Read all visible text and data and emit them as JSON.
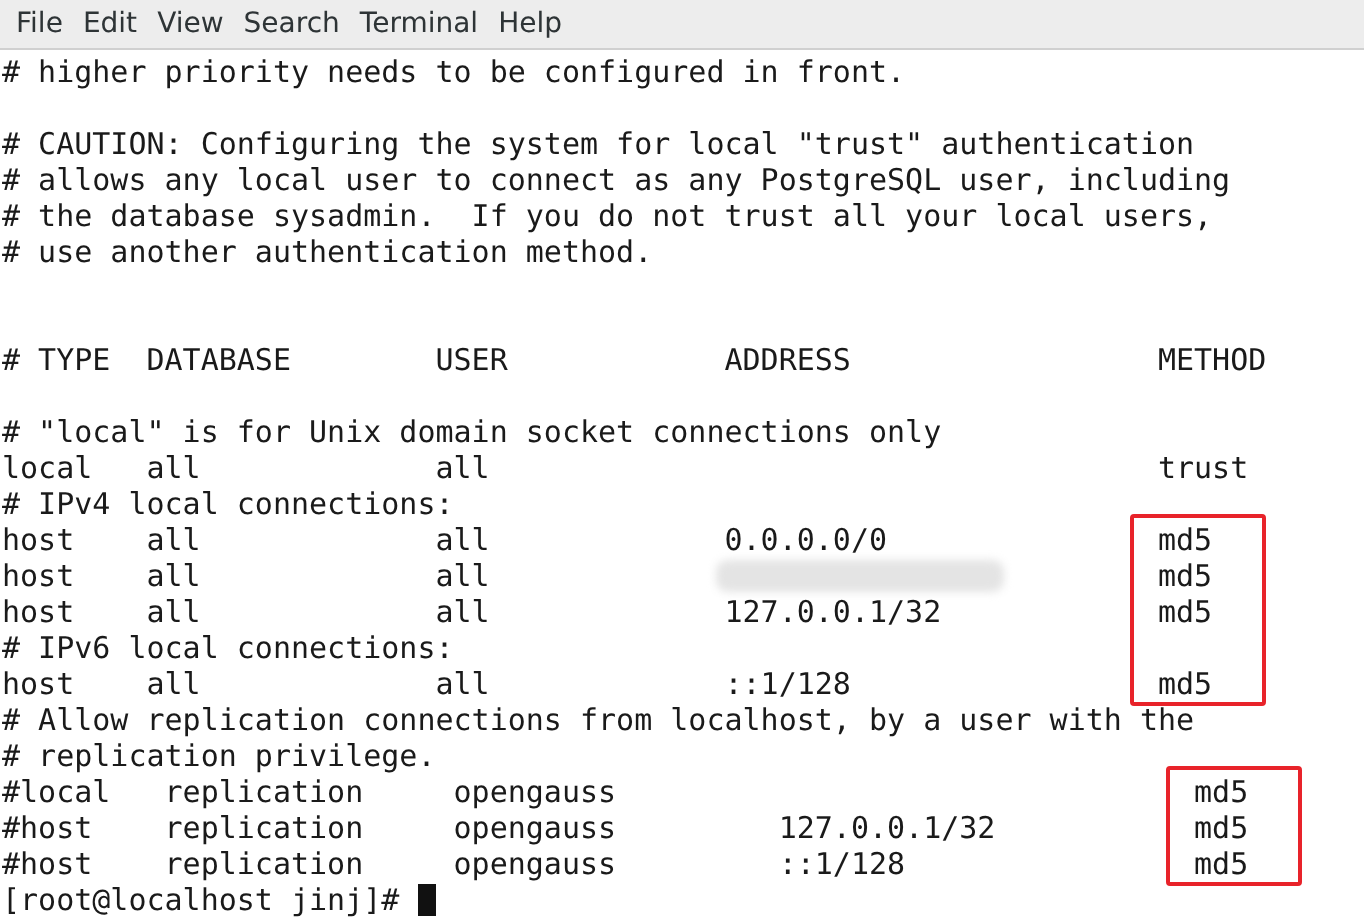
{
  "menu": [
    "File",
    "Edit",
    "View",
    "Search",
    "Terminal",
    "Help"
  ],
  "blocks": [
    {
      "boxed": false,
      "lines": [
        {
          "text": "# higher priority needs to be configured in front."
        },
        {
          "kind": "blank"
        },
        {
          "text": "# CAUTION: Configuring the system for local \"trust\" authentication"
        },
        {
          "text": "# allows any local user to connect as any PostgreSQL user, including"
        },
        {
          "text": "# the database sysadmin.  If you do not trust all your local users,"
        },
        {
          "text": "# use another authentication method."
        },
        {
          "kind": "blank"
        },
        {
          "kind": "blank"
        },
        {
          "text": "# TYPE  DATABASE        USER            ADDRESS                 METHOD"
        },
        {
          "kind": "blank"
        },
        {
          "text": "# \"local\" is for Unix domain socket connections only"
        },
        {
          "text": "local   all             all                                     trust"
        },
        {
          "text": "# IPv4 local connections:"
        }
      ]
    },
    {
      "boxed": true,
      "lines": [
        {
          "text": "host    all             all             0.0.0.0/0               ",
          "method": "md5"
        },
        {
          "text": "host    all             all                                     ",
          "method": "md5",
          "redacted": true
        },
        {
          "text": "host    all             all             127.0.0.1/32            ",
          "method": "md5"
        },
        {
          "text": "# IPv6 local connections:"
        },
        {
          "text": "host    all             all             ::1/128                 ",
          "method": "md5"
        }
      ]
    },
    {
      "boxed": false,
      "lines": [
        {
          "text": "# Allow replication connections from localhost, by a user with the"
        },
        {
          "text": "# replication privilege."
        }
      ]
    },
    {
      "boxed": true,
      "lines": [
        {
          "text": "#local   replication     opengauss                                ",
          "method": "md5"
        },
        {
          "text": "#host    replication     opengauss         127.0.0.1/32           ",
          "method": "md5"
        },
        {
          "text": "#host    replication     opengauss         ::1/128                ",
          "method": "md5"
        }
      ]
    }
  ],
  "prompt": "[root@localhost jinj]# "
}
